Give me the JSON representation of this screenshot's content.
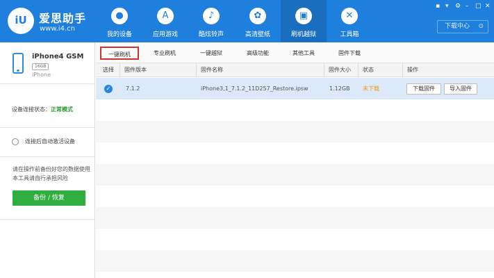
{
  "brand": {
    "logo_text": "iU",
    "title": "爱思助手",
    "url": "www.i4.cn"
  },
  "nav": [
    {
      "label": "我的设备",
      "icon": "apple-icon"
    },
    {
      "label": "应用游戏",
      "icon": "app-store-icon"
    },
    {
      "label": "酷炫铃声",
      "icon": "bell-icon"
    },
    {
      "label": "高清壁纸",
      "icon": "flower-icon"
    },
    {
      "label": "刷机越狱",
      "icon": "box-icon"
    },
    {
      "label": "工具箱",
      "icon": "tools-icon"
    }
  ],
  "active_nav": "刷机越狱",
  "download_center": {
    "label": "下载中心"
  },
  "device": {
    "name": "iPhone4 GSM",
    "capacity": "16GB",
    "model": "iPhone"
  },
  "connection": {
    "label": "设备连接状态：",
    "value": "正常模式"
  },
  "auto_activate": {
    "label": "连接后自动激活设备",
    "checked": false
  },
  "notice": "请在操作前备份好您的数据使用本工具请自行承担风险",
  "backup_button": "备份 / 恢复",
  "tabs": [
    "一键刷机",
    "专业刷机",
    "一键越狱",
    "高级功能",
    "其他工具",
    "固件下载"
  ],
  "active_tab": "一键刷机",
  "table": {
    "headers": [
      "选择",
      "固件版本",
      "固件名称",
      "固件大小",
      "状态",
      "操作"
    ],
    "rows": [
      {
        "selected": true,
        "version": "7.1.2",
        "name": "iPhone3,1_7.1.2_11D257_Restore.ipsw",
        "size": "1.12GB",
        "status": "未下载",
        "actions": [
          "下载固件",
          "导入固件"
        ]
      }
    ]
  },
  "colors": {
    "header": "#1f7fdc",
    "accent_green": "#2fad3f",
    "status_orange": "#f29b1a",
    "ok_green": "#2e9a2e",
    "active_tab_border": "#d32f2f"
  }
}
